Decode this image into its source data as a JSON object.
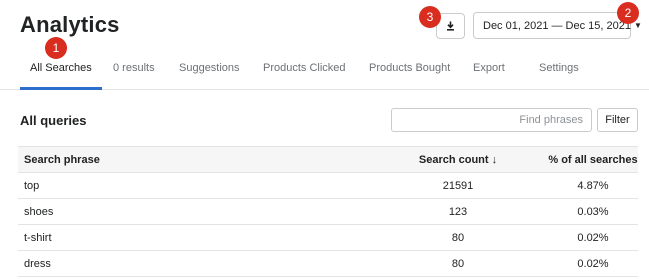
{
  "header": {
    "title": "Analytics",
    "date_range": "Dec 01, 2021 — Dec 15, 2021"
  },
  "markers": [
    "1",
    "2",
    "3"
  ],
  "tabs": [
    {
      "label": "All Searches",
      "active": true
    },
    {
      "label": "0 results",
      "active": false
    },
    {
      "label": "Suggestions",
      "active": false
    },
    {
      "label": "Products Clicked",
      "active": false
    },
    {
      "label": "Products Bought",
      "active": false
    },
    {
      "label": "Export",
      "active": false
    },
    {
      "label": "Settings",
      "active": false
    }
  ],
  "section": {
    "title": "All queries",
    "search_placeholder": "Find phrases",
    "filter_label": "Filter"
  },
  "table": {
    "columns": [
      "Search phrase",
      "Search count ↓",
      "% of all searches"
    ],
    "rows": [
      [
        "top",
        "21591",
        "4.87%"
      ],
      [
        "shoes",
        "123",
        "0.03%"
      ],
      [
        "t-shirt",
        "80",
        "0.02%"
      ],
      [
        "dress",
        "80",
        "0.02%"
      ]
    ]
  },
  "colors": {
    "accent": "#2c6ecb",
    "marker": "#d92d20"
  },
  "icons": {
    "download": "download-icon",
    "date_caret": "caret-down-icon"
  }
}
